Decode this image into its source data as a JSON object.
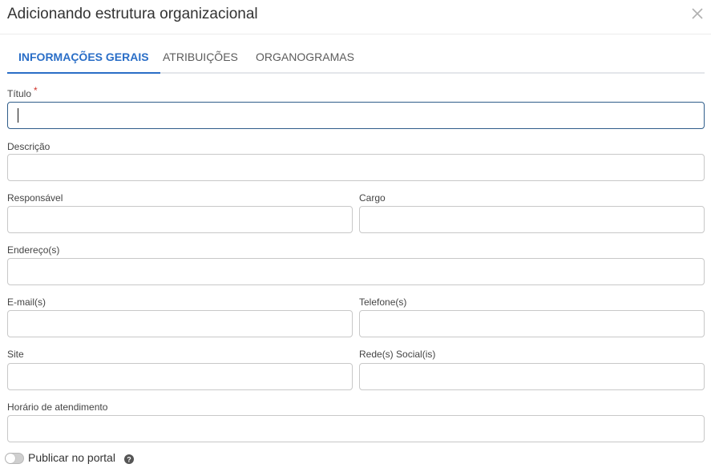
{
  "modal": {
    "title": "Adicionando estrutura organizacional",
    "close_icon": "close-icon"
  },
  "tabs": [
    {
      "label": "INFORMAÇÕES GERAIS",
      "active": true
    },
    {
      "label": "ATRIBUIÇÕES",
      "active": false
    },
    {
      "label": "ORGANOGRAMAS",
      "active": false
    }
  ],
  "form": {
    "titulo": {
      "label": "Título",
      "required_mark": "*",
      "value": ""
    },
    "descricao": {
      "label": "Descrição",
      "value": ""
    },
    "responsavel": {
      "label": "Responsável",
      "value": ""
    },
    "cargo": {
      "label": "Cargo",
      "value": ""
    },
    "endereco": {
      "label": "Endereço(s)",
      "value": ""
    },
    "email": {
      "label": "E-mail(s)",
      "value": ""
    },
    "telefone": {
      "label": "Telefone(s)",
      "value": ""
    },
    "site": {
      "label": "Site",
      "value": ""
    },
    "rede_social": {
      "label": "Rede(s) Social(is)",
      "value": ""
    },
    "horario": {
      "label": "Horário de atendimento",
      "value": ""
    }
  },
  "publicar": {
    "label": "Publicar no portal",
    "enabled": false,
    "help_icon": "question-circle-icon"
  },
  "colors": {
    "accent": "#2a6ec7",
    "required": "#d0342c",
    "focus_border": "#2f5d8a"
  }
}
